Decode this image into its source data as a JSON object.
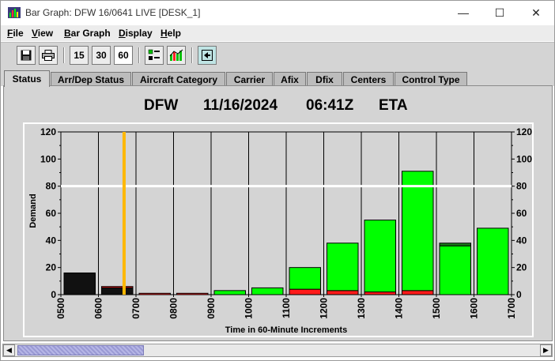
{
  "window": {
    "title": "Bar Graph: DFW 16/0641 LIVE [DESK_1]",
    "controls": {
      "minimize": "—",
      "maximize": "☐",
      "close": "✕"
    }
  },
  "menu": [
    {
      "underline": "F",
      "rest": "ile"
    },
    {
      "underline": "V",
      "rest": "iew"
    },
    {
      "underline": "B",
      "rest": "ar Graph"
    },
    {
      "underline": "D",
      "rest": "isplay"
    },
    {
      "underline": "H",
      "rest": "elp"
    }
  ],
  "toolbar": {
    "save_icon": "floppy-disk-icon",
    "print_icon": "printer-icon",
    "interval_15": "15",
    "interval_30": "30",
    "interval_60": "60",
    "selected_interval": "60",
    "legend_icon": "legend-icon",
    "graph_icon": "bar-graph-icon",
    "nav_icon": "arrow-left-icon"
  },
  "tabs": [
    "Status",
    "Arr/Dep Status",
    "Aircraft Category",
    "Carrier",
    "Afix",
    "Dfix",
    "Centers",
    "Control Type"
  ],
  "selected_tab": "Status",
  "header": {
    "airport": "DFW",
    "date": "11/16/2024",
    "time": "06:41Z",
    "mode": "ETA"
  },
  "chart_data": {
    "type": "bar",
    "stacked": true,
    "xlabel": "Time in 60-Minute Increments",
    "ylabel": "Demand",
    "ylim": [
      0,
      120
    ],
    "yticks": [
      0,
      20,
      40,
      60,
      80,
      100,
      120
    ],
    "categories": [
      "0500",
      "0600",
      "0700",
      "0800",
      "0900",
      "1000",
      "1100",
      "1200",
      "1300",
      "1400",
      "1500",
      "1600",
      "1700"
    ],
    "bars": [
      {
        "black": 16,
        "red": 0,
        "green": 0,
        "darkgreen": 0
      },
      {
        "black": 5,
        "red": 1,
        "green": 0,
        "darkgreen": 0
      },
      {
        "black": 0,
        "red": 1,
        "green": 0,
        "darkgreen": 0
      },
      {
        "black": 0,
        "red": 1,
        "green": 0,
        "darkgreen": 0
      },
      {
        "black": 0,
        "red": 0,
        "green": 3,
        "darkgreen": 0
      },
      {
        "black": 0,
        "red": 0,
        "green": 5,
        "darkgreen": 0
      },
      {
        "black": 0,
        "red": 4,
        "green": 16,
        "darkgreen": 0
      },
      {
        "black": 0,
        "red": 3,
        "green": 35,
        "darkgreen": 0
      },
      {
        "black": 0,
        "red": 2,
        "green": 53,
        "darkgreen": 0
      },
      {
        "black": 0,
        "red": 3,
        "green": 88,
        "darkgreen": 0
      },
      {
        "black": 0,
        "red": 0,
        "green": 36,
        "darkgreen": 2
      },
      {
        "black": 0,
        "red": 0,
        "green": 49,
        "darkgreen": 0
      }
    ],
    "threshold_line": 80,
    "current_time_marker": "06:41",
    "colors": {
      "black": "#111111",
      "red": "#ff1a1a",
      "green": "#00ff00",
      "darkgreen": "#1a7a1a",
      "threshold": "#ffffff",
      "current_time": "#ffb800",
      "plot_bg": "#d4d4d4",
      "grid": "#000000"
    }
  }
}
